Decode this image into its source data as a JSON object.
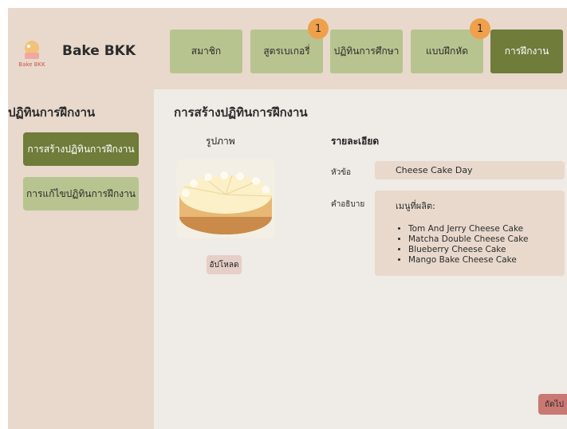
{
  "brand": {
    "name": "Bake BKK",
    "logo_text": "Bake BKK"
  },
  "nav": {
    "tabs": [
      {
        "label": "สมาชิก",
        "badge": null,
        "active": false
      },
      {
        "label": "สูตรเบเกอรี่",
        "badge": "1",
        "active": false
      },
      {
        "label": "ปฏิทินการศึกษา",
        "badge": null,
        "active": false
      },
      {
        "label": "แบบฝึกหัด",
        "badge": "1",
        "active": false
      },
      {
        "label": "การฝึกงาน",
        "badge": null,
        "active": true
      }
    ]
  },
  "sidebar": {
    "title": "ปฏิทินการฝึกงาน",
    "items": [
      {
        "label": "การสร้างปฏิทินการฝึกงาน",
        "active": true
      },
      {
        "label": "การแก้ไขปฏิทินการฝึกงาน",
        "active": false
      }
    ]
  },
  "main": {
    "title": "การสร้างปฏิทินการฝึกงาน",
    "image_heading": "รูปภาพ",
    "details_heading": "รายละเอียด",
    "upload_label": "อัปโหลด",
    "topic_label": "หัวข้อ",
    "topic_value": "Cheese Cake Day",
    "desc_label": "คำอธิบาย",
    "desc_intro": "เมนูที่ผลิต:",
    "desc_items": [
      "Tom And Jerry Cheese Cake",
      "Matcha Double Cheese Cake",
      "Blueberry Cheese Cake",
      "Mango Bake Cheese Cake"
    ],
    "next_label": "ถัดไป"
  },
  "colors": {
    "background": "#e8d9cc",
    "main_panel": "#efebe6",
    "tab": "#b8c48f",
    "tab_active": "#6f7c3a",
    "badge": "#f0a04b",
    "next_button": "#c97873"
  },
  "icons": {
    "logo": "bakery-logo-icon",
    "cake_image": "cheesecake-image"
  }
}
